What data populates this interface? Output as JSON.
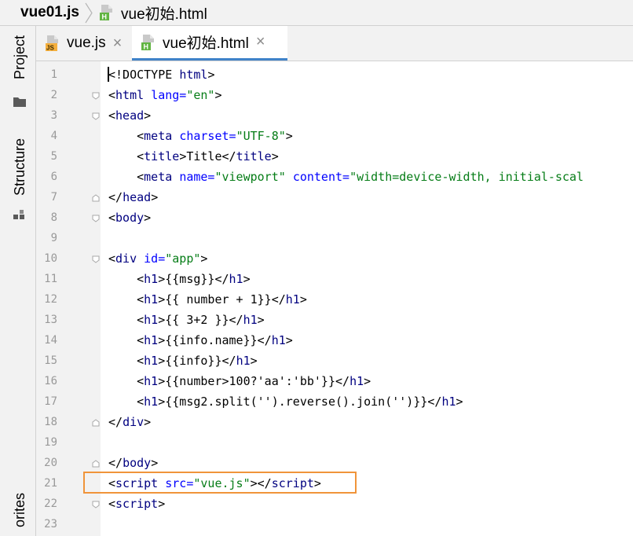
{
  "breadcrumb": {
    "project": "vue01.js",
    "file": "vue初始.html"
  },
  "toolwindows": {
    "project": "Project",
    "structure": "Structure",
    "favorites": "orites"
  },
  "tabs": [
    {
      "label": "vue.js",
      "close": "×",
      "icon": "js-file-icon",
      "active": false
    },
    {
      "label": "vue初始.html",
      "close": "×",
      "icon": "html-file-icon",
      "active": true
    }
  ],
  "editor": {
    "lines": [
      {
        "n": "1",
        "parts": [
          {
            "c": "",
            "s": "<!DOCTYPE "
          },
          {
            "c": "t",
            "s": "html"
          },
          {
            "c": "",
            "s": ">"
          }
        ]
      },
      {
        "n": "2",
        "parts": [
          {
            "c": "",
            "s": "<"
          },
          {
            "c": "t",
            "s": "html"
          },
          {
            "c": "",
            "s": " "
          },
          {
            "c": "a",
            "s": "lang="
          },
          {
            "c": "v",
            "s": "\"en\""
          },
          {
            "c": "",
            "s": ">"
          }
        ]
      },
      {
        "n": "3",
        "parts": [
          {
            "c": "",
            "s": "<"
          },
          {
            "c": "t",
            "s": "head"
          },
          {
            "c": "",
            "s": ">"
          }
        ]
      },
      {
        "n": "4",
        "parts": [
          {
            "c": "",
            "s": "    <"
          },
          {
            "c": "t",
            "s": "meta"
          },
          {
            "c": "",
            "s": " "
          },
          {
            "c": "a",
            "s": "charset="
          },
          {
            "c": "v",
            "s": "\"UTF-8\""
          },
          {
            "c": "",
            "s": ">"
          }
        ]
      },
      {
        "n": "5",
        "parts": [
          {
            "c": "",
            "s": "    <"
          },
          {
            "c": "t",
            "s": "title"
          },
          {
            "c": "",
            "s": ">Title</"
          },
          {
            "c": "t",
            "s": "title"
          },
          {
            "c": "",
            "s": ">"
          }
        ]
      },
      {
        "n": "6",
        "parts": [
          {
            "c": "",
            "s": "    <"
          },
          {
            "c": "t",
            "s": "meta"
          },
          {
            "c": "",
            "s": " "
          },
          {
            "c": "a",
            "s": "name="
          },
          {
            "c": "v",
            "s": "\"viewport\""
          },
          {
            "c": "",
            "s": " "
          },
          {
            "c": "a",
            "s": "content="
          },
          {
            "c": "v",
            "s": "\"width=device-width, initial-scal"
          }
        ]
      },
      {
        "n": "7",
        "parts": [
          {
            "c": "",
            "s": "</"
          },
          {
            "c": "t",
            "s": "head"
          },
          {
            "c": "",
            "s": ">"
          }
        ]
      },
      {
        "n": "8",
        "parts": [
          {
            "c": "",
            "s": "<"
          },
          {
            "c": "t",
            "s": "body"
          },
          {
            "c": "",
            "s": ">"
          }
        ]
      },
      {
        "n": "9",
        "parts": []
      },
      {
        "n": "10",
        "parts": [
          {
            "c": "",
            "s": "<"
          },
          {
            "c": "t",
            "s": "div"
          },
          {
            "c": "",
            "s": " "
          },
          {
            "c": "a",
            "s": "id="
          },
          {
            "c": "v",
            "s": "\"app\""
          },
          {
            "c": "",
            "s": ">"
          }
        ]
      },
      {
        "n": "11",
        "parts": [
          {
            "c": "",
            "s": "    <"
          },
          {
            "c": "t",
            "s": "h1"
          },
          {
            "c": "",
            "s": ">{{msg}}</"
          },
          {
            "c": "t",
            "s": "h1"
          },
          {
            "c": "",
            "s": ">"
          }
        ]
      },
      {
        "n": "12",
        "parts": [
          {
            "c": "",
            "s": "    <"
          },
          {
            "c": "t",
            "s": "h1"
          },
          {
            "c": "",
            "s": ">{{ number + 1}}</"
          },
          {
            "c": "t",
            "s": "h1"
          },
          {
            "c": "",
            "s": ">"
          }
        ]
      },
      {
        "n": "13",
        "parts": [
          {
            "c": "",
            "s": "    <"
          },
          {
            "c": "t",
            "s": "h1"
          },
          {
            "c": "",
            "s": ">{{ 3+2 }}</"
          },
          {
            "c": "t",
            "s": "h1"
          },
          {
            "c": "",
            "s": ">"
          }
        ]
      },
      {
        "n": "14",
        "parts": [
          {
            "c": "",
            "s": "    <"
          },
          {
            "c": "t",
            "s": "h1"
          },
          {
            "c": "",
            "s": ">{{info.name}}</"
          },
          {
            "c": "t",
            "s": "h1"
          },
          {
            "c": "",
            "s": ">"
          }
        ]
      },
      {
        "n": "15",
        "parts": [
          {
            "c": "",
            "s": "    <"
          },
          {
            "c": "t",
            "s": "h1"
          },
          {
            "c": "",
            "s": ">{{info}}</"
          },
          {
            "c": "t",
            "s": "h1"
          },
          {
            "c": "",
            "s": ">"
          }
        ]
      },
      {
        "n": "16",
        "parts": [
          {
            "c": "",
            "s": "    <"
          },
          {
            "c": "t",
            "s": "h1"
          },
          {
            "c": "",
            "s": ">{{number>100?'aa':'bb'}}</"
          },
          {
            "c": "t",
            "s": "h1"
          },
          {
            "c": "",
            "s": ">"
          }
        ]
      },
      {
        "n": "17",
        "parts": [
          {
            "c": "",
            "s": "    <"
          },
          {
            "c": "t",
            "s": "h1"
          },
          {
            "c": "",
            "s": ">{{msg2.split('').reverse().join('')}}</"
          },
          {
            "c": "t",
            "s": "h1"
          },
          {
            "c": "",
            "s": ">"
          }
        ]
      },
      {
        "n": "18",
        "parts": [
          {
            "c": "",
            "s": "</"
          },
          {
            "c": "t",
            "s": "div"
          },
          {
            "c": "",
            "s": ">"
          }
        ]
      },
      {
        "n": "19",
        "parts": []
      },
      {
        "n": "20",
        "parts": [
          {
            "c": "",
            "s": "</"
          },
          {
            "c": "t",
            "s": "body"
          },
          {
            "c": "",
            "s": ">"
          }
        ]
      },
      {
        "n": "21",
        "parts": [
          {
            "c": "",
            "s": "<"
          },
          {
            "c": "t",
            "s": "script"
          },
          {
            "c": "",
            "s": " "
          },
          {
            "c": "a",
            "s": "src="
          },
          {
            "c": "v",
            "s": "\"vue.js\""
          },
          {
            "c": "",
            "s": "></"
          },
          {
            "c": "t",
            "s": "script"
          },
          {
            "c": "",
            "s": ">"
          }
        ]
      },
      {
        "n": "22",
        "parts": [
          {
            "c": "",
            "s": "<"
          },
          {
            "c": "t",
            "s": "script"
          },
          {
            "c": "",
            "s": ">"
          }
        ]
      },
      {
        "n": "23",
        "parts": []
      }
    ],
    "highlighted_line": "21"
  },
  "colors": {
    "tag": "#000080",
    "attribute": "#0000ff",
    "value": "#067d17",
    "highlight_border": "#f0943a",
    "active_tab_underline": "#4083c9"
  }
}
